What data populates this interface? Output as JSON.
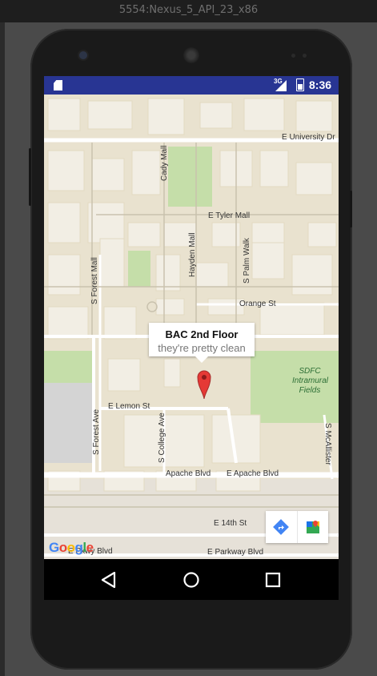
{
  "emulator": {
    "window_title": "5554:Nexus_5_API_23_x86"
  },
  "status_bar": {
    "network_type": "3G",
    "time": "8:36",
    "battery_level": 0.55
  },
  "map": {
    "streets": {
      "e_university_dr": "E University Dr",
      "cady_mall": "Cady Mall",
      "e_tyler_mall": "E Tyler Mall",
      "s_forest_mall": "S Forest Mall",
      "hayden_mall": "Hayden Mall",
      "s_palm_walk": "S Palm Walk",
      "orange_st": "Orange St",
      "e_lemon_st": "E Lemon St",
      "s_forest_ave": "S Forest Ave",
      "s_college_ave": "S College Ave",
      "apache_blvd": "Apache Blvd",
      "e_apache_blvd": "E Apache Blvd",
      "s_mcallister": "S McAllister",
      "e_14th_st": "E 14th St",
      "e_parkway_blvd_left": "E Pkwy Blvd",
      "e_parkway_blvd": "E Parkway Blvd"
    },
    "field_label": "SDFC Intramural Fields",
    "info_window": {
      "title": "BAC 2nd Floor",
      "snippet": "they're pretty clean"
    },
    "marker_color": "#e53935",
    "logo_text": "Google"
  },
  "colors": {
    "status_bar": "#283593",
    "map_base": "#e9e2cf",
    "building": "#f2eee4",
    "road": "#ffffff",
    "park": "#c5dea9",
    "directions_button": "#4285f4"
  }
}
